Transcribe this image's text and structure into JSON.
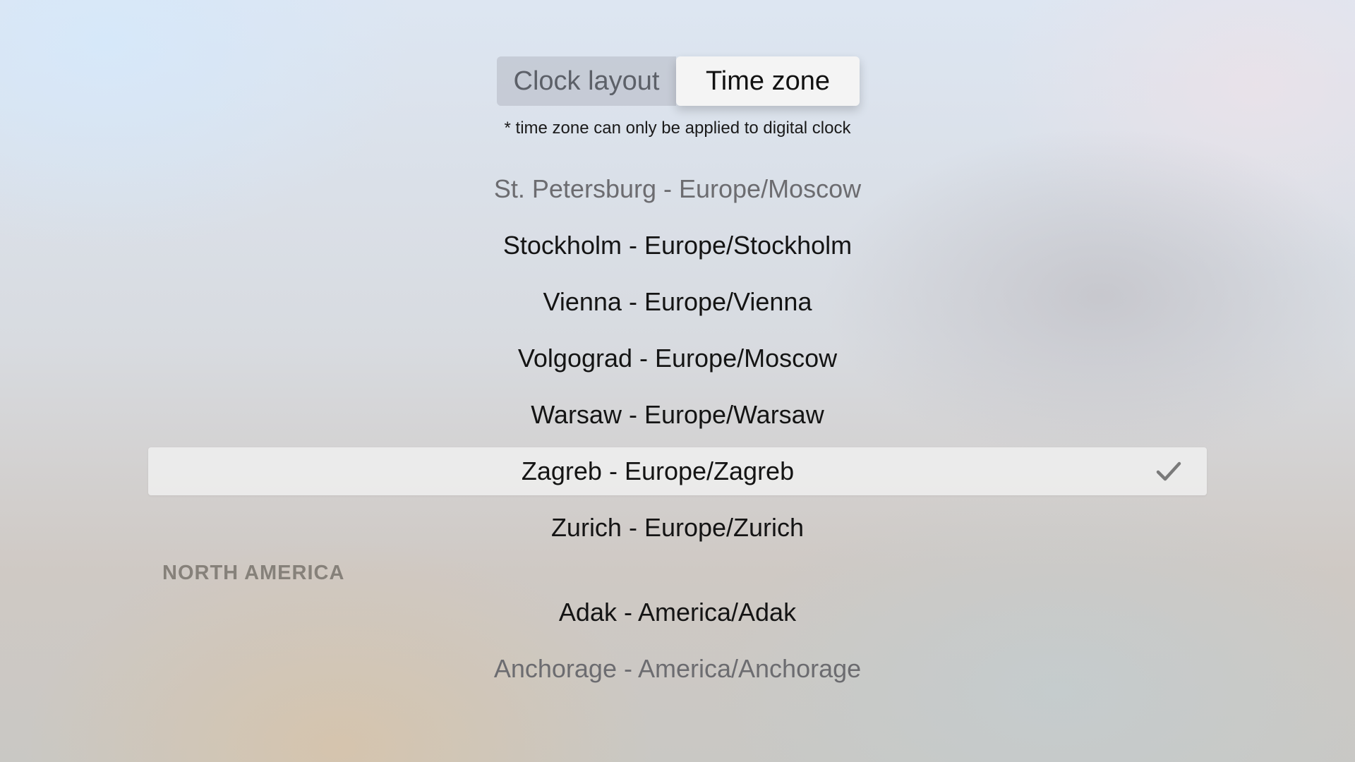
{
  "tabs": {
    "clock_layout": "Clock layout",
    "time_zone": "Time zone",
    "active": "time_zone"
  },
  "note": "* time zone can only be applied to digital clock",
  "list": {
    "europe_items": [
      {
        "label": "St. Petersburg - Europe/Moscow",
        "state": "faded"
      },
      {
        "label": "Stockholm - Europe/Stockholm",
        "state": "normal"
      },
      {
        "label": "Vienna - Europe/Vienna",
        "state": "normal"
      },
      {
        "label": "Volgograd - Europe/Moscow",
        "state": "normal"
      },
      {
        "label": "Warsaw - Europe/Warsaw",
        "state": "normal"
      },
      {
        "label": "Zagreb - Europe/Zagreb",
        "state": "selected"
      },
      {
        "label": "Zurich - Europe/Zurich",
        "state": "normal"
      }
    ],
    "north_america_header": "NORTH AMERICA",
    "north_america_items": [
      {
        "label": "Adak - America/Adak",
        "state": "normal"
      },
      {
        "label": "Anchorage - America/Anchorage",
        "state": "faded"
      }
    ]
  },
  "icons": {
    "selected_marker": "checkmark-icon"
  },
  "colors": {
    "text_primary": "#141414",
    "text_faded": "#6c6c70",
    "section_header": "#86817a",
    "check": "#7a7a7a"
  }
}
